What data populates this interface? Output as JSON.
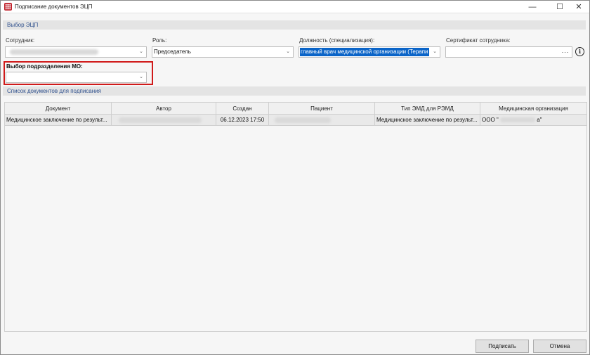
{
  "window": {
    "title": "Подписание документов ЭЦП",
    "minimize": "—",
    "maximize": "☐",
    "close": "✕"
  },
  "sections": {
    "ecp": "Выбор ЭЦП",
    "docs": "Список документов для подписания"
  },
  "form": {
    "employee": {
      "label": "Сотрудник:",
      "value": ""
    },
    "role": {
      "label": "Роль:",
      "value": "Председатель"
    },
    "position": {
      "label": "Должность (специализация):",
      "value": "главный врач медицинской организации (Терапи"
    },
    "certificate": {
      "label": "Сертификат сотрудника:",
      "value": "",
      "browse": "···"
    },
    "subdivision": {
      "label": "Выбор подразделения МО:",
      "value": ""
    }
  },
  "table": {
    "columns": [
      "Документ",
      "Автор",
      "Создан",
      "Пациент",
      "Тип ЭМД для РЭМД",
      "Медицинская организация"
    ],
    "rows": [
      {
        "document": "Медицинское заключение по результ...",
        "author": "",
        "created": "06.12.2023 17:50",
        "patient": "",
        "emd_type": "Медицинское заключение по результ...",
        "org_prefix": "ООО \"",
        "org_suffix": "а\""
      }
    ]
  },
  "buttons": {
    "sign": "Подписать",
    "cancel": "Отмена"
  },
  "colors": {
    "section_text": "#2e4f8c",
    "selection": "#0a64c8",
    "highlight": "#d01a1a",
    "app_icon": "#c0202a"
  },
  "icons": {
    "app": "grid-calendar-icon",
    "dropdown": "chevron-down-icon",
    "info": "info-icon"
  }
}
